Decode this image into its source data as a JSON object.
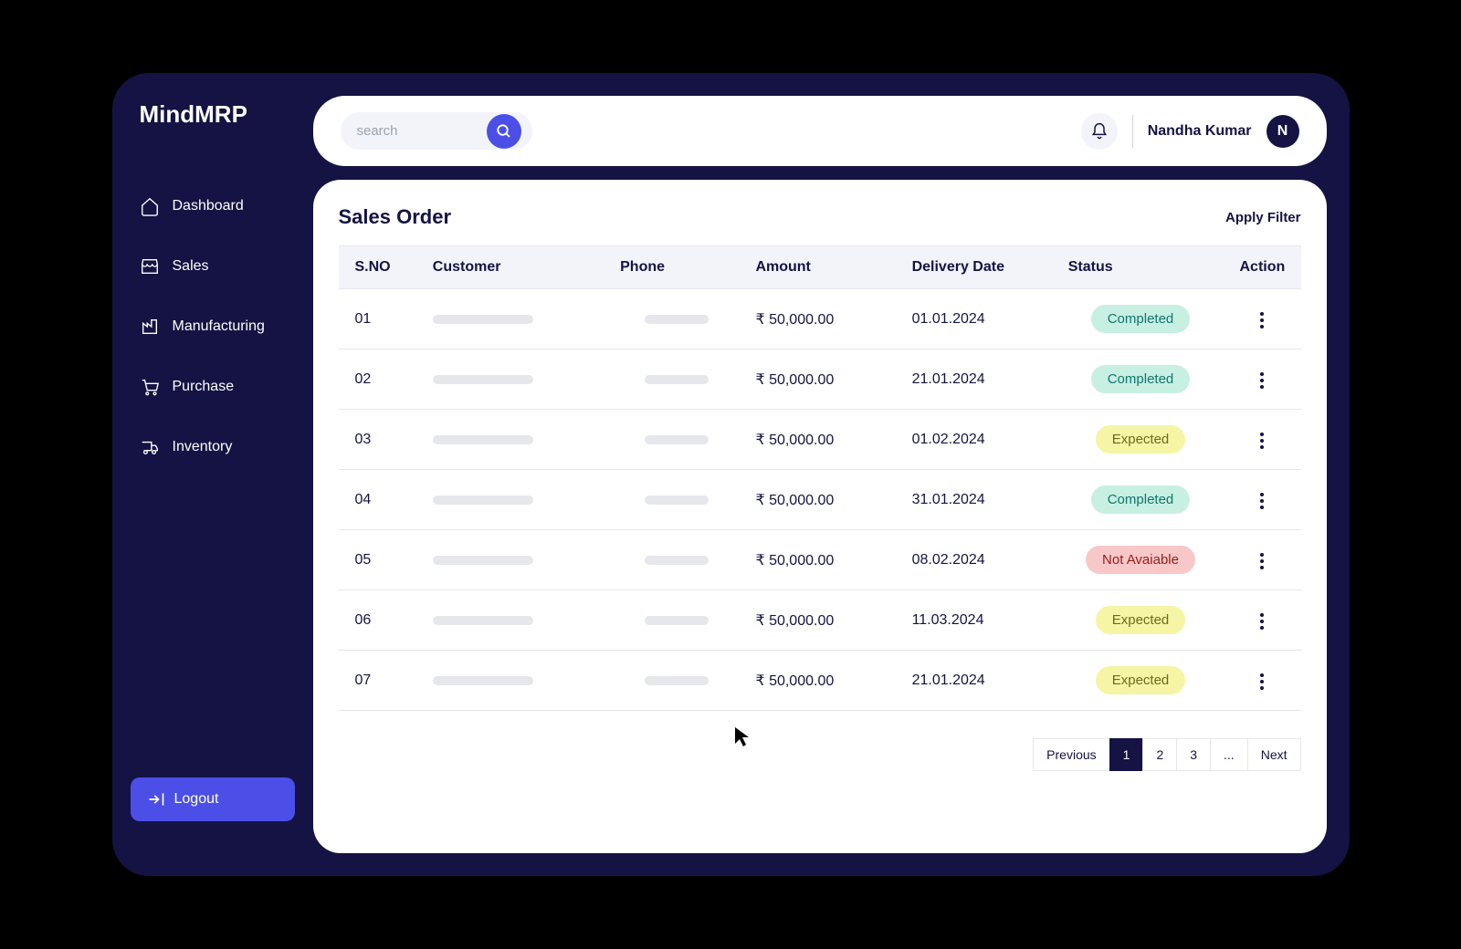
{
  "brand": "MindMRP",
  "sidebar": {
    "items": [
      {
        "label": "Dashboard"
      },
      {
        "label": "Sales"
      },
      {
        "label": "Manufacturing"
      },
      {
        "label": "Purchase"
      },
      {
        "label": "Inventory"
      }
    ],
    "logout_label": "Logout"
  },
  "search": {
    "placeholder": "search",
    "value": ""
  },
  "user": {
    "name": "Nandha Kumar",
    "initial": "N"
  },
  "page": {
    "title": "Sales Order",
    "filter_label": "Apply Filter"
  },
  "table": {
    "headers": {
      "sno": "S.NO",
      "customer": "Customer",
      "phone": "Phone",
      "amount": "Amount",
      "delivery": "Delivery Date",
      "status": "Status",
      "action": "Action"
    },
    "rows": [
      {
        "sno": "01",
        "amount": "₹ 50,000.00",
        "delivery": "01.01.2024",
        "status": "Completed",
        "status_class": "completed"
      },
      {
        "sno": "02",
        "amount": "₹ 50,000.00",
        "delivery": "21.01.2024",
        "status": "Completed",
        "status_class": "completed"
      },
      {
        "sno": "03",
        "amount": "₹ 50,000.00",
        "delivery": "01.02.2024",
        "status": "Expected",
        "status_class": "expected"
      },
      {
        "sno": "04",
        "amount": "₹ 50,000.00",
        "delivery": "31.01.2024",
        "status": "Completed",
        "status_class": "completed"
      },
      {
        "sno": "05",
        "amount": "₹ 50,000.00",
        "delivery": "08.02.2024",
        "status": "Not Avaiable",
        "status_class": "notavailable"
      },
      {
        "sno": "06",
        "amount": "₹ 50,000.00",
        "delivery": "11.03.2024",
        "status": "Expected",
        "status_class": "expected"
      },
      {
        "sno": "07",
        "amount": "₹ 50,000.00",
        "delivery": "21.01.2024",
        "status": "Expected",
        "status_class": "expected"
      }
    ]
  },
  "pagination": {
    "prev": "Previous",
    "pages": [
      "1",
      "2",
      "3",
      "..."
    ],
    "next": "Next",
    "active": "1"
  }
}
